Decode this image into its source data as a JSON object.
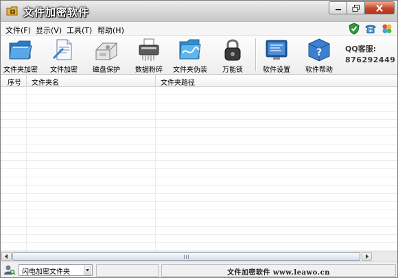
{
  "window": {
    "title": "文件加密软件"
  },
  "menu": {
    "items": [
      "文件(F)",
      "显示(V)",
      "工具(T)",
      "帮助(H)"
    ],
    "right_icons": [
      "shield-check-icon",
      "phone-icon",
      "clover-icon"
    ]
  },
  "toolbar": {
    "buttons": [
      {
        "label": "文件夹加密",
        "icon": "folder-lock-icon"
      },
      {
        "label": "文件加密",
        "icon": "file-lock-icon"
      },
      {
        "label": "磁盘保护",
        "icon": "disk-protect-icon"
      },
      {
        "label": "数据粉碎",
        "icon": "shredder-icon"
      },
      {
        "label": "文件夹伪装",
        "icon": "folder-disguise-icon"
      },
      {
        "label": "万能锁",
        "icon": "padlock-icon"
      },
      {
        "label": "软件设置",
        "icon": "settings-screen-icon"
      },
      {
        "label": "软件帮助",
        "icon": "help-cube-icon"
      }
    ],
    "qq_label": "QQ客服:",
    "qq_number": "876292449"
  },
  "list": {
    "columns": [
      "序号",
      "文件夹名",
      "文件夹路径"
    ],
    "rows": []
  },
  "status": {
    "combo_value": "闪电加密文件夹",
    "panel_text": "",
    "footer_text": "文件加密软件  www.leawo.cn"
  },
  "colors": {
    "close_button": "#c8432a",
    "title_text": "#ffffff"
  }
}
